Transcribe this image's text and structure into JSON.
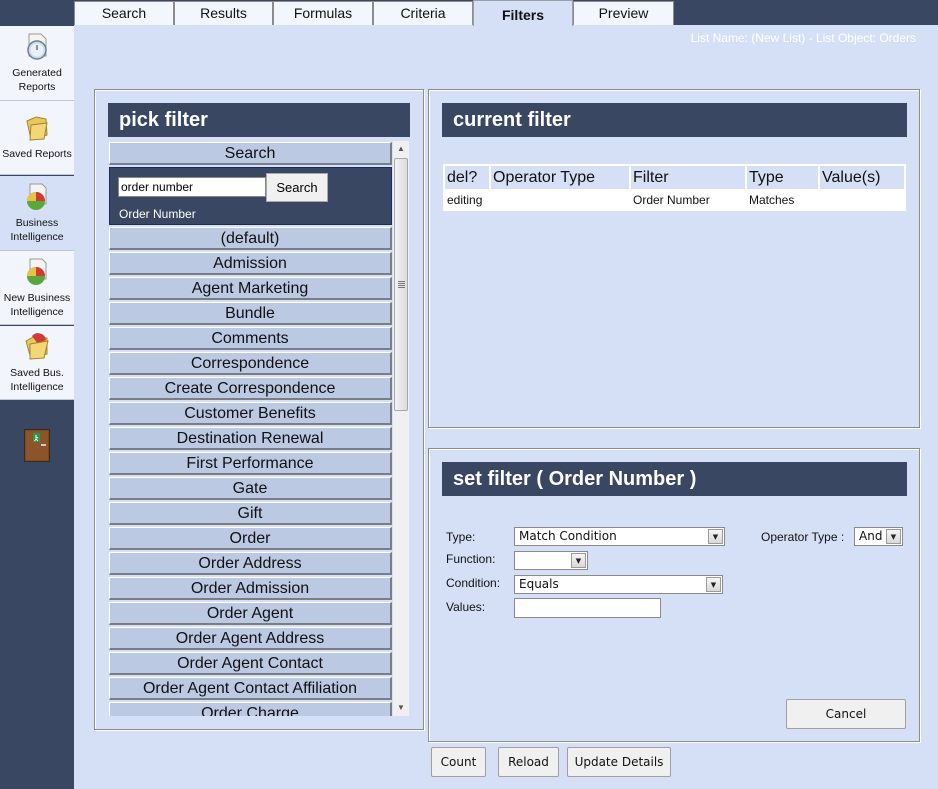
{
  "sidebar": {
    "items": [
      {
        "label": "Generated Reports",
        "icon": "report-clock-icon"
      },
      {
        "label": "Saved Reports",
        "icon": "folder-icon"
      },
      {
        "label": "Business Intelligence",
        "icon": "pie-chart-document-icon"
      },
      {
        "label": "New Business Intelligence",
        "icon": "pie-chart-document-icon"
      },
      {
        "label": "Saved Bus. Intelligence",
        "icon": "pie-chart-folder-icon"
      }
    ],
    "exit_icon": "exit-door-icon"
  },
  "tabs": [
    {
      "label": "Search"
    },
    {
      "label": "Results"
    },
    {
      "label": "Formulas"
    },
    {
      "label": "Criteria"
    },
    {
      "label": "Filters",
      "active": true
    },
    {
      "label": "Preview"
    }
  ],
  "list_name": "List Name: (New List) - List Object: Orders",
  "pick_filter": {
    "title": "pick filter",
    "search_header": "Search",
    "search_value": "order number",
    "search_button": "Search",
    "search_result": "Order Number",
    "categories": [
      "(default)",
      "Admission",
      "Agent Marketing",
      "Bundle",
      "Comments",
      "Correspondence",
      "Create Correspondence",
      "Customer Benefits",
      "Destination Renewal",
      "First Performance",
      "Gate",
      "Gift",
      "Order",
      "Order Address",
      "Order Admission",
      "Order Agent",
      "Order Agent Address",
      "Order Agent Contact",
      "Order Agent Contact Affiliation",
      "Order Charge"
    ]
  },
  "current_filter": {
    "title": "current filter",
    "columns": [
      "del?",
      "Operator Type",
      "Filter",
      "Type",
      "Value(s)"
    ],
    "rows": [
      [
        "editing",
        "",
        "Order Number",
        "Matches",
        ""
      ]
    ]
  },
  "set_filter": {
    "title": "set filter ( Order Number )",
    "type_label": "Type:",
    "type_value": "Match Condition",
    "function_label": "Function:",
    "function_value": "",
    "condition_label": "Condition:",
    "condition_value": "Equals",
    "values_label": "Values:",
    "values_value": "",
    "operator_label": "Operator Type :",
    "operator_value": "And",
    "cancel": "Cancel"
  },
  "actions": {
    "count": "Count",
    "reload": "Reload",
    "update_details": "Update Details"
  }
}
